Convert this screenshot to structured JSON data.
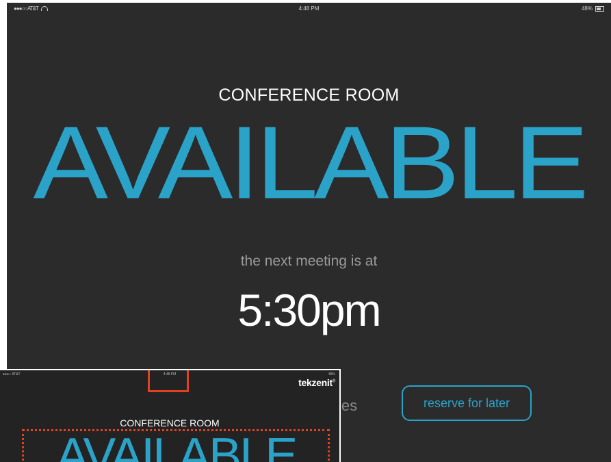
{
  "statusbar": {
    "carrier": "●●●○○ AT&T",
    "time": "4:48 PM",
    "battery": "48%"
  },
  "room": {
    "title": "CONFERENCE ROOM",
    "status": "AVAILABLE",
    "next_label": "the next meeting is at",
    "next_time": "5:30pm",
    "partial_text": "les",
    "reserve_label": "reserve for later"
  },
  "colors": {
    "background": "#2b2b2c",
    "accent": "#2ba3c9",
    "highlight": "#e0421f"
  },
  "inset": {
    "carrier": "●●●○ AT&T",
    "time": "4:48 PM",
    "battery": "48%",
    "brand": "tekzenit",
    "brand_mark": "®",
    "room_title": "CONFERENCE ROOM",
    "status": "AVAILABLE"
  },
  "icons": [
    "wifi-icon",
    "battery-icon"
  ]
}
